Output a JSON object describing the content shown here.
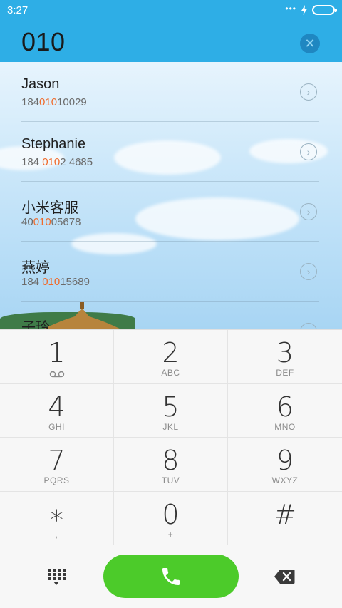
{
  "status_bar": {
    "time": "3:27",
    "dots": "•••"
  },
  "dial_input": {
    "value": "010",
    "clear_icon": "clear-circle-icon"
  },
  "contacts": [
    {
      "name": "Jason",
      "number_pre": "184",
      "number_match": "010",
      "number_post": "10029"
    },
    {
      "name": "Stephanie",
      "number_pre": "184 ",
      "number_match": "010",
      "number_post": "2 4685"
    },
    {
      "name": "小米客服",
      "number_pre": "40",
      "number_match": "010",
      "number_post": "05678"
    },
    {
      "name": "燕婷",
      "number_pre": "184 ",
      "number_match": "010",
      "number_post": "15689"
    },
    {
      "name": "子玲",
      "number_pre": "",
      "number_match": "",
      "number_post": ""
    }
  ],
  "keypad": [
    {
      "digit": "1",
      "letters": ""
    },
    {
      "digit": "2",
      "letters": "ABC"
    },
    {
      "digit": "3",
      "letters": "DEF"
    },
    {
      "digit": "4",
      "letters": "GHI"
    },
    {
      "digit": "5",
      "letters": "JKL"
    },
    {
      "digit": "6",
      "letters": "MNO"
    },
    {
      "digit": "7",
      "letters": "PQRS"
    },
    {
      "digit": "8",
      "letters": "TUV"
    },
    {
      "digit": "9",
      "letters": "WXYZ"
    },
    {
      "digit": "∗",
      "letters": ","
    },
    {
      "digit": "0",
      "letters": "+"
    },
    {
      "digit": "#",
      "letters": ""
    }
  ],
  "colors": {
    "header": "#2eaee6",
    "call_button": "#4ccb2a",
    "match_highlight": "#f06a2a"
  },
  "icons": {
    "dialpad": "dialpad-grid-icon",
    "call": "phone-icon",
    "backspace": "backspace-icon",
    "voicemail": "voicemail-icon",
    "detail": "chevron-right-circle-icon"
  }
}
